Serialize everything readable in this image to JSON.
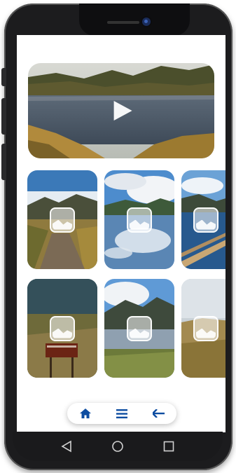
{
  "device": {
    "frame_color": "#1c1c1e",
    "screen_color": "#ffffff"
  },
  "video": {
    "icon": "play-icon",
    "scene": "mountain-lake"
  },
  "gallery": {
    "rows": [
      [
        {
          "scene": "dirt-path",
          "icon": "image-icon"
        },
        {
          "scene": "lake-reflection",
          "icon": "image-icon"
        },
        {
          "scene": "lake-railing",
          "icon": "image-icon"
        }
      ],
      [
        {
          "scene": "trail-sign",
          "icon": "image-icon"
        },
        {
          "scene": "marsh",
          "icon": "image-icon"
        },
        {
          "scene": "meadow",
          "icon": "image-icon"
        }
      ]
    ]
  },
  "nav": {
    "accent": "#0d4da1",
    "items": [
      {
        "icon": "home-icon"
      },
      {
        "icon": "menu-icon"
      },
      {
        "icon": "back-arrow-icon"
      }
    ]
  },
  "system_nav": {
    "items": [
      {
        "icon": "back-triangle-icon"
      },
      {
        "icon": "home-circle-icon"
      },
      {
        "icon": "recents-square-icon"
      }
    ]
  }
}
